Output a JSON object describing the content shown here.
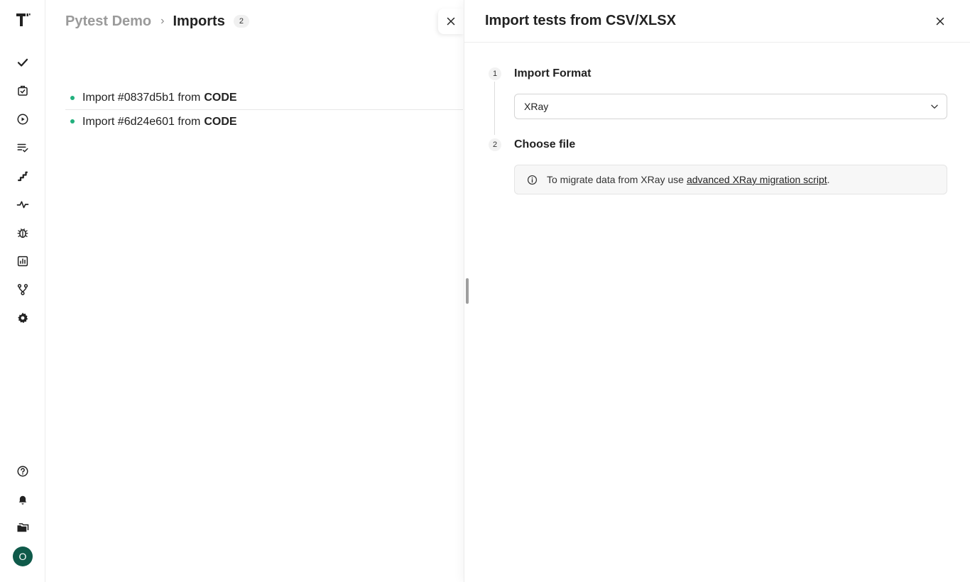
{
  "breadcrumb": {
    "project": "Pytest Demo",
    "separator": "›",
    "current": "Imports",
    "count": "2"
  },
  "imports": [
    {
      "label": "Import #0837d5b1 from",
      "source": "CODE"
    },
    {
      "label": "Import #6d24e601 from",
      "source": "CODE"
    }
  ],
  "sidebar": {
    "logo": "T",
    "items": [
      "check-icon",
      "clipboard-check-icon",
      "play-circle-icon",
      "checklist-icon",
      "steps-icon",
      "pulse-icon",
      "bug-icon",
      "chart-icon",
      "branch-icon",
      "gear-icon"
    ],
    "bottom": [
      "help-icon",
      "bell-icon",
      "folder-icon"
    ],
    "avatar_initial": "O"
  },
  "drawer": {
    "title": "Import tests from CSV/XLSX",
    "steps": [
      {
        "number": "1",
        "title": "Import Format"
      },
      {
        "number": "2",
        "title": "Choose file"
      }
    ],
    "format_value": "XRay",
    "info_text": "To migrate data from XRay use",
    "info_link": "advanced XRay migration script",
    "info_end": "."
  },
  "colors": {
    "status_dot": "#22b07d",
    "avatar_bg": "#0f5a4a"
  }
}
